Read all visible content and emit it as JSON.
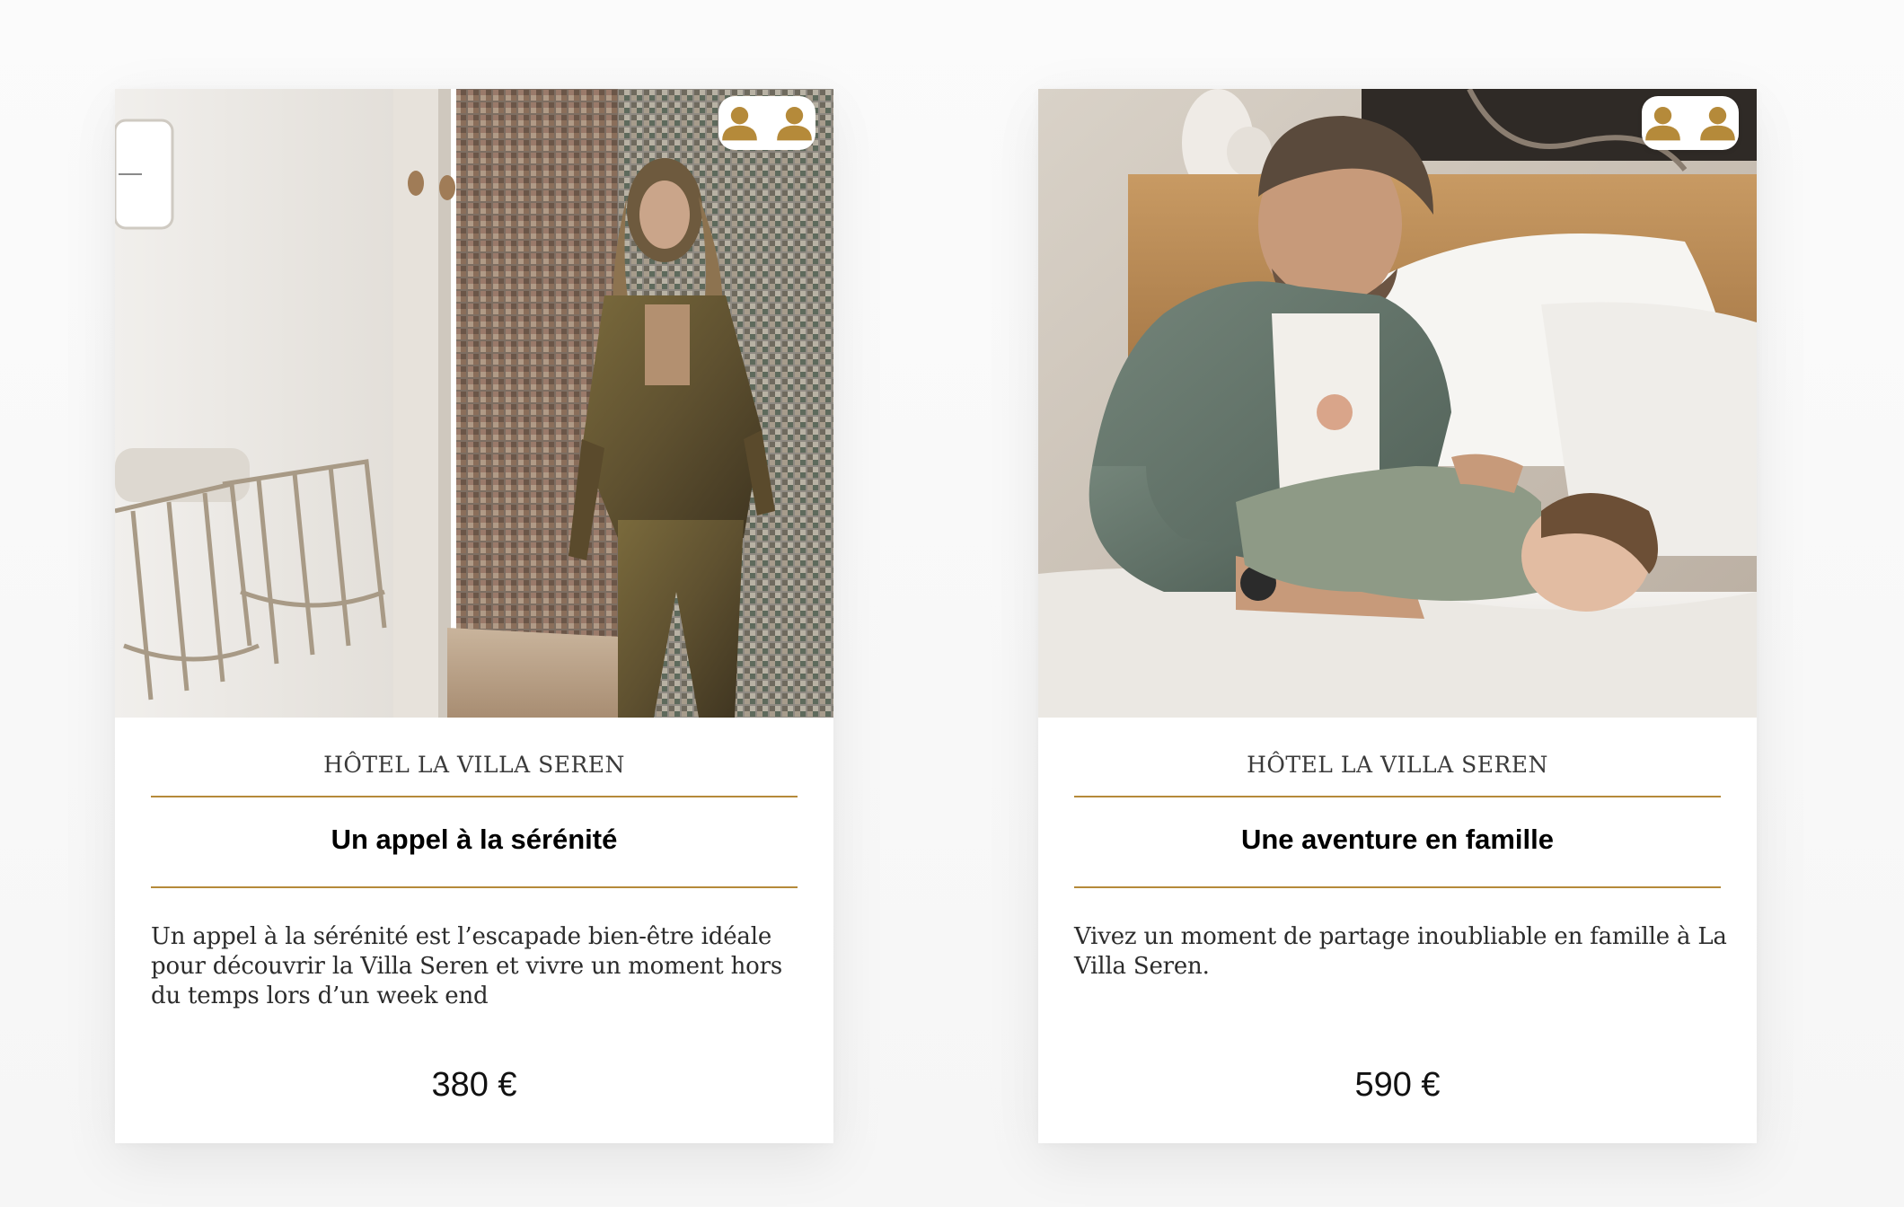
{
  "colors": {
    "accent": "#b58a3a",
    "card_bg": "#ffffff",
    "page_bg": "#fafafa",
    "title_text": "#000000",
    "body_text": "#2c2c2c"
  },
  "offers": [
    {
      "image_icon": "woman-in-hotel-bathroom-photo",
      "guests_icon": "two-persons-icon",
      "guests_count": 2,
      "hotel": "HÔTEL LA VILLA SEREN",
      "title": "Un appel à la sérénité",
      "description": "Un appel à la sérénité est l’escapade bien-être idéale pour découvrir la Villa Seren et vivre un moment hors du temps lors d’un week end",
      "price": "380 €"
    },
    {
      "image_icon": "father-and-child-on-bed-photo",
      "guests_icon": "two-persons-icon",
      "guests_count": 2,
      "hotel": "HÔTEL LA VILLA SEREN",
      "title": "Une aventure en famille",
      "description": "Vivez un moment de partage inoubliable en famille à La Villa Seren.",
      "price": "590 €"
    }
  ]
}
